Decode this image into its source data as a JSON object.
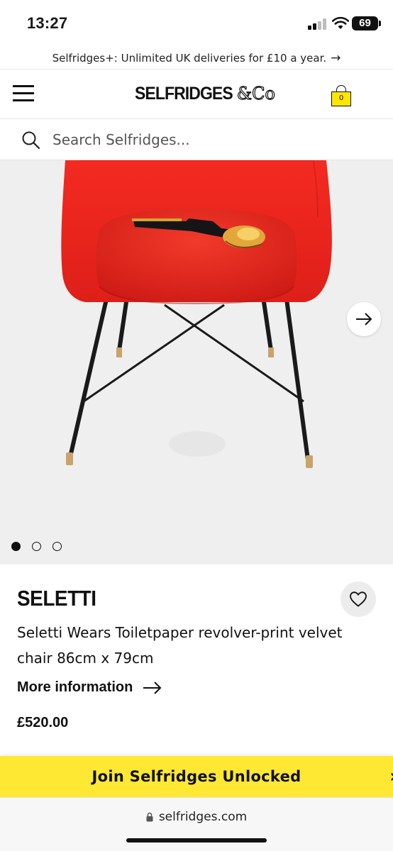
{
  "status_bar": {
    "time": "13:27",
    "battery": "69"
  },
  "promo": {
    "text": "Selfridges+: Unlimited UK deliveries for £10 a year.",
    "arrow": "→"
  },
  "header": {
    "logo_main": "SELFRIDGES",
    "logo_co": "&Co",
    "bag_count": "0"
  },
  "search": {
    "placeholder": "Search Selfridges..."
  },
  "gallery": {
    "image_count": 3,
    "active_index": 0
  },
  "product": {
    "brand": "SELETTI",
    "title": "Seletti Wears Toiletpaper revolver-print velvet chair 86cm x 79cm",
    "more_info_label": "More information",
    "price": "£520.00"
  },
  "banner": {
    "text": "Join Selfridges Unlocked"
  },
  "browser": {
    "url": "selfridges.com"
  },
  "colors": {
    "accent_yellow": "#ffe833",
    "chair_red": "#e8231e",
    "text": "#111111"
  }
}
